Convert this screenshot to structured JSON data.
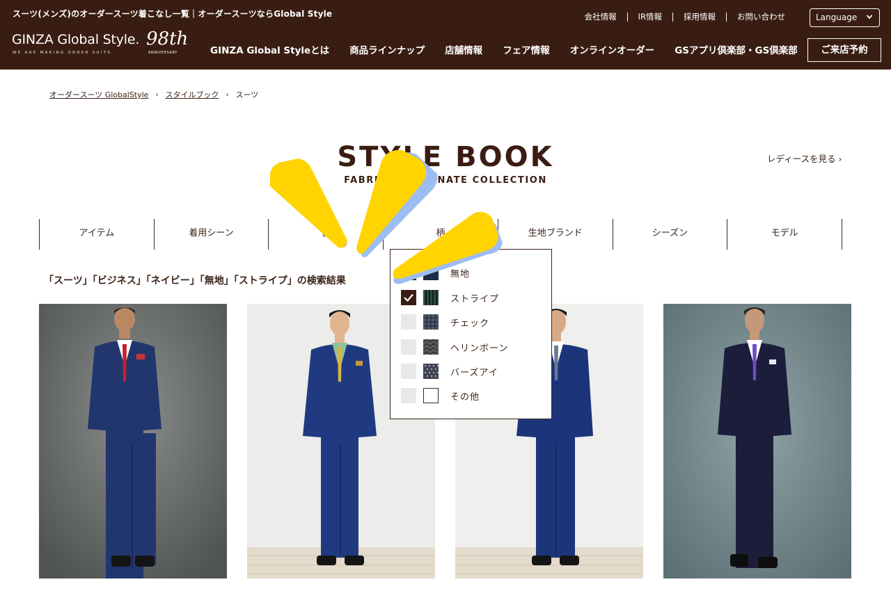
{
  "header": {
    "tagline": "スーツ(メンズ)のオーダースーツ着こなし一覧｜オーダースーツならGlobal Style",
    "logo_name": "GINZA Global Style.",
    "logo_sub": "WE ARE MAKING ORDER SUITS",
    "logo_anniversary": "98th",
    "logo_anniversary_sub": "ANNIVERSARY",
    "util_links": [
      "会社情報",
      "IR情報",
      "採用情報",
      "お問い合わせ"
    ],
    "language_label": "Language",
    "main_nav": [
      "GINZA Global Styleとは",
      "商品ラインナップ",
      "店舗情報",
      "フェア情報",
      "オンラインオーダー",
      "GSアプリ倶楽部・GS倶楽部"
    ],
    "reserve_label": "ご来店予約"
  },
  "breadcrumb": {
    "items": [
      "オーダースーツ GlobalStyle",
      "スタイルブック",
      "スーツ"
    ],
    "separator": "›"
  },
  "title": {
    "main": "STYLE BOOK",
    "sub": "FABRIC COORDINATE COLLECTION",
    "ladies_link": "レディースを見る ›"
  },
  "filters": [
    "アイテム",
    "着用シーン",
    "色",
    "柄",
    "生地ブランド",
    "シーズン",
    "モデル"
  ],
  "results": {
    "heading": "「スーツ」「ビジネス」「ネイビー」「無地」「ストライプ」の検索結果"
  },
  "pattern_dropdown": {
    "options": [
      {
        "label": "無地",
        "checked": true
      },
      {
        "label": "ストライプ",
        "checked": true
      },
      {
        "label": "チェック",
        "checked": false
      },
      {
        "label": "ヘリンボーン",
        "checked": false
      },
      {
        "label": "バーズアイ",
        "checked": false
      },
      {
        "label": "その他",
        "checked": false
      }
    ]
  },
  "colors": {
    "brand_brown": "#3a1d12",
    "text_brown": "#3a2418",
    "overlay_yellow": "#ffd400",
    "overlay_blue": "#9dbcf2"
  },
  "icons": {
    "language_dropdown": "chevron-down-icon",
    "checkbox": "checkmark-icon"
  }
}
